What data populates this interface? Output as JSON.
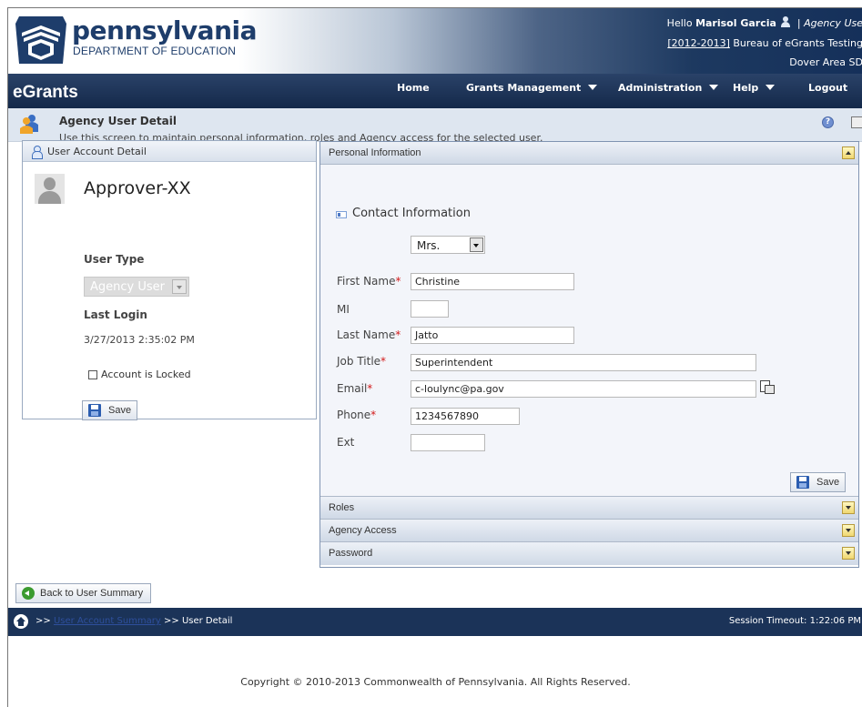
{
  "header": {
    "logo_name": "pennsylvania",
    "logo_sub": "DEPARTMENT OF EDUCATION",
    "greeting": "Hello",
    "user_name": "Marisol Garcia",
    "separator": "|",
    "user_role": "Agency Use",
    "year_link": "[2012-2013]",
    "agency": "Bureau of eGrants Testing",
    "district": "Dover Area SD"
  },
  "nav": {
    "brand": "eGrants",
    "items": [
      {
        "label": "Home",
        "dropdown": false
      },
      {
        "label": "Grants Management",
        "dropdown": true
      },
      {
        "label": "Administration",
        "dropdown": true
      },
      {
        "label": "Help",
        "dropdown": true
      },
      {
        "label": "Logout",
        "dropdown": false
      }
    ]
  },
  "page": {
    "title": "Agency User Detail",
    "description": "Use this screen to maintain personal information, roles and Agency access for the selected user."
  },
  "user_account": {
    "panel_title": "User Account Detail",
    "account_name": "Approver-XX",
    "user_type_label": "User Type",
    "user_type_value": "Agency User",
    "last_login_label": "Last Login",
    "last_login_value": "3/27/2013 2:35:02 PM",
    "locked_label": "Account is Locked",
    "locked": false,
    "save_label": "Save"
  },
  "personal_info": {
    "section_title": "Personal Information",
    "contact_title": "Contact Information",
    "name_title": "Mrs.",
    "fields": {
      "first_name": {
        "label": "First Name",
        "required": true,
        "value": "Christine"
      },
      "mi": {
        "label": "MI",
        "required": false,
        "value": ""
      },
      "last_name": {
        "label": "Last Name",
        "required": true,
        "value": "Jatto"
      },
      "job_title": {
        "label": "Job Title",
        "required": true,
        "value": "Superintendent"
      },
      "email": {
        "label": "Email",
        "required": true,
        "value": "c-loulync@pa.gov"
      },
      "phone": {
        "label": "Phone",
        "required": true,
        "value": "1234567890"
      },
      "ext": {
        "label": "Ext",
        "required": false,
        "value": ""
      }
    },
    "required_mark": "*",
    "save_label": "Save"
  },
  "sections": {
    "roles": "Roles",
    "agency_access": "Agency Access",
    "password": "Password"
  },
  "back_label": "Back to User Summary",
  "footer": {
    "crumb_sep1": ">>",
    "crumb_link": "User Account Summary",
    "crumb_sep2": ">>",
    "crumb_current": "User Detail",
    "session_label": "Session Timeout:",
    "session_time": "1:22:06 PM",
    "copyright": "Copyright © 2010-2013 Commonwealth of Pennsylvania. All Rights Reserved."
  },
  "colors": {
    "navy": "#1b3358",
    "required": "#d21a1a",
    "panel_bg": "#f3f5fa"
  },
  "icons": [
    "keystone-logo-icon",
    "user-icon",
    "users-icon",
    "help-icon",
    "print-icon",
    "user-account-icon",
    "avatar",
    "disk-icon",
    "contact-card-icon",
    "address-book-icon",
    "home-icon",
    "back-arrow-icon"
  ]
}
